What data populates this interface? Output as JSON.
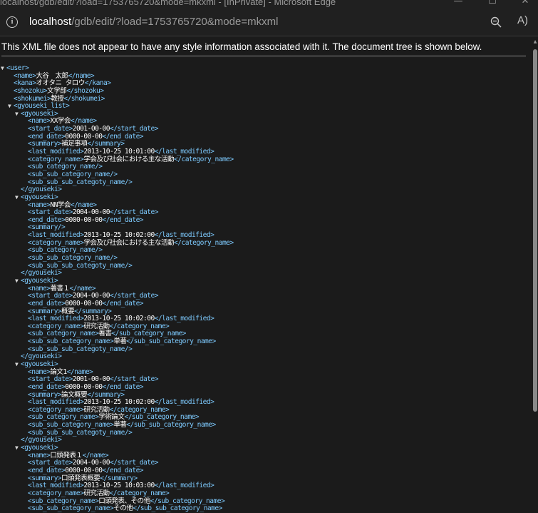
{
  "window": {
    "title": "localhost/gdb/edit/?load=1753765720&mode=mkxml - [InPrivate] - Microsoft Edge",
    "minimize_glyph": "—",
    "maximize_glyph": "☐",
    "close_glyph": "✕"
  },
  "address_bar": {
    "host": "localhost",
    "path": "/gdb/edit/?load=1753765720&mode=mkxml",
    "info_icon": "info-icon",
    "zoom_icon": "zoom-out-icon",
    "read_aloud_label": "A)"
  },
  "banner_text": "This XML file does not appear to have any style information associated with it. The document tree is shown below.",
  "xml_lines": [
    {
      "d": 0,
      "t": 1,
      "o": "<user>",
      "v": "",
      "c": ""
    },
    {
      "d": 1,
      "t": 0,
      "o": "<name>",
      "v": "大谷　太郎",
      "c": "</name>"
    },
    {
      "d": 1,
      "t": 0,
      "o": "<kana>",
      "v": "オオタニ タロウ",
      "c": "</kana>"
    },
    {
      "d": 1,
      "t": 0,
      "o": "<shozoku>",
      "v": "文学部",
      "c": "</shozoku>"
    },
    {
      "d": 1,
      "t": 0,
      "o": "<shokumei>",
      "v": "教授",
      "c": "</shokumei>"
    },
    {
      "d": 1,
      "t": 1,
      "o": "<gyouseki_list>",
      "v": "",
      "c": ""
    },
    {
      "d": 2,
      "t": 1,
      "o": "<gyouseki>",
      "v": "",
      "c": ""
    },
    {
      "d": 3,
      "t": 0,
      "o": "<name>",
      "v": "XX学会",
      "c": "</name>"
    },
    {
      "d": 3,
      "t": 0,
      "o": "<start_date>",
      "v": "2001-00-00",
      "c": "</start_date>"
    },
    {
      "d": 3,
      "t": 0,
      "o": "<end_date>",
      "v": "0000-00-00",
      "c": "</end_date>"
    },
    {
      "d": 3,
      "t": 0,
      "o": "<summary>",
      "v": "補足事項",
      "c": "</summary>"
    },
    {
      "d": 3,
      "t": 0,
      "o": "<last_modified>",
      "v": "2013-10-25 10:01:00",
      "c": "</last_modified>"
    },
    {
      "d": 3,
      "t": 0,
      "o": "<category_name>",
      "v": "学会及び社会における主な活動",
      "c": "</category_name>"
    },
    {
      "d": 3,
      "t": 0,
      "o": "<sub_category_name/>",
      "v": "",
      "c": ""
    },
    {
      "d": 3,
      "t": 0,
      "o": "<sub_sub_category_name/>",
      "v": "",
      "c": ""
    },
    {
      "d": 3,
      "t": 0,
      "o": "<sub_sub_sub_categoty_name/>",
      "v": "",
      "c": ""
    },
    {
      "d": 2,
      "t": 0,
      "o": "</gyouseki>",
      "v": "",
      "c": ""
    },
    {
      "d": 2,
      "t": 1,
      "o": "<gyouseki>",
      "v": "",
      "c": ""
    },
    {
      "d": 3,
      "t": 0,
      "o": "<name>",
      "v": "NN学会",
      "c": "</name>"
    },
    {
      "d": 3,
      "t": 0,
      "o": "<start_date>",
      "v": "2004-00-00",
      "c": "</start_date>"
    },
    {
      "d": 3,
      "t": 0,
      "o": "<end_date>",
      "v": "0000-00-00",
      "c": "</end_date>"
    },
    {
      "d": 3,
      "t": 0,
      "o": "<summary/>",
      "v": "",
      "c": ""
    },
    {
      "d": 3,
      "t": 0,
      "o": "<last_modified>",
      "v": "2013-10-25 10:02:00",
      "c": "</last_modified>"
    },
    {
      "d": 3,
      "t": 0,
      "o": "<category_name>",
      "v": "学会及び社会における主な活動",
      "c": "</category_name>"
    },
    {
      "d": 3,
      "t": 0,
      "o": "<sub_category_name/>",
      "v": "",
      "c": ""
    },
    {
      "d": 3,
      "t": 0,
      "o": "<sub_sub_category_name/>",
      "v": "",
      "c": ""
    },
    {
      "d": 3,
      "t": 0,
      "o": "<sub_sub_sub_categoty_name/>",
      "v": "",
      "c": ""
    },
    {
      "d": 2,
      "t": 0,
      "o": "</gyouseki>",
      "v": "",
      "c": ""
    },
    {
      "d": 2,
      "t": 1,
      "o": "<gyouseki>",
      "v": "",
      "c": ""
    },
    {
      "d": 3,
      "t": 0,
      "o": "<name>",
      "v": "著書１",
      "c": "</name>"
    },
    {
      "d": 3,
      "t": 0,
      "o": "<start_date>",
      "v": "2004-00-00",
      "c": "</start_date>"
    },
    {
      "d": 3,
      "t": 0,
      "o": "<end_date>",
      "v": "0000-00-00",
      "c": "</end_date>"
    },
    {
      "d": 3,
      "t": 0,
      "o": "<summary>",
      "v": "概要",
      "c": "</summary>"
    },
    {
      "d": 3,
      "t": 0,
      "o": "<last_modified>",
      "v": "2013-10-25 10:02:00",
      "c": "</last_modified>"
    },
    {
      "d": 3,
      "t": 0,
      "o": "<category_name>",
      "v": "研究活動",
      "c": "</category_name>"
    },
    {
      "d": 3,
      "t": 0,
      "o": "<sub_category_name>",
      "v": "著書",
      "c": "</sub_category_name>"
    },
    {
      "d": 3,
      "t": 0,
      "o": "<sub_sub_category_name>",
      "v": "単著",
      "c": "</sub_sub_category_name>"
    },
    {
      "d": 3,
      "t": 0,
      "o": "<sub_sub_sub_categoty_name/>",
      "v": "",
      "c": ""
    },
    {
      "d": 2,
      "t": 0,
      "o": "</gyouseki>",
      "v": "",
      "c": ""
    },
    {
      "d": 2,
      "t": 1,
      "o": "<gyouseki>",
      "v": "",
      "c": ""
    },
    {
      "d": 3,
      "t": 0,
      "o": "<name>",
      "v": "論文1",
      "c": "</name>"
    },
    {
      "d": 3,
      "t": 0,
      "o": "<start_date>",
      "v": "2001-00-00",
      "c": "</start_date>"
    },
    {
      "d": 3,
      "t": 0,
      "o": "<end_date>",
      "v": "0000-00-00",
      "c": "</end_date>"
    },
    {
      "d": 3,
      "t": 0,
      "o": "<summary>",
      "v": "論文概要",
      "c": "</summary>"
    },
    {
      "d": 3,
      "t": 0,
      "o": "<last_modified>",
      "v": "2013-10-25 10:02:00",
      "c": "</last_modified>"
    },
    {
      "d": 3,
      "t": 0,
      "o": "<category_name>",
      "v": "研究活動",
      "c": "</category_name>"
    },
    {
      "d": 3,
      "t": 0,
      "o": "<sub_category_name>",
      "v": "学術論文",
      "c": "</sub_category_name>"
    },
    {
      "d": 3,
      "t": 0,
      "o": "<sub_sub_category_name>",
      "v": "単著",
      "c": "</sub_sub_category_name>"
    },
    {
      "d": 3,
      "t": 0,
      "o": "<sub_sub_sub_categoty_name/>",
      "v": "",
      "c": ""
    },
    {
      "d": 2,
      "t": 0,
      "o": "</gyouseki>",
      "v": "",
      "c": ""
    },
    {
      "d": 2,
      "t": 1,
      "o": "<gyouseki>",
      "v": "",
      "c": ""
    },
    {
      "d": 3,
      "t": 0,
      "o": "<name>",
      "v": "口頭発表１",
      "c": "</name>"
    },
    {
      "d": 3,
      "t": 0,
      "o": "<start_date>",
      "v": "2004-00-00",
      "c": "</start_date>"
    },
    {
      "d": 3,
      "t": 0,
      "o": "<end_date>",
      "v": "0000-00-00",
      "c": "</end_date>"
    },
    {
      "d": 3,
      "t": 0,
      "o": "<summary>",
      "v": "口頭発表概要",
      "c": "</summary>"
    },
    {
      "d": 3,
      "t": 0,
      "o": "<last_modified>",
      "v": "2013-10-25 10:03:00",
      "c": "</last_modified>"
    },
    {
      "d": 3,
      "t": 0,
      "o": "<category_name>",
      "v": "研究活動",
      "c": "</category_name>"
    },
    {
      "d": 3,
      "t": 0,
      "o": "<sub_category_name>",
      "v": "口頭発表、その他",
      "c": "</sub_category_name>"
    },
    {
      "d": 3,
      "t": 0,
      "o": "<sub_sub_category_name>",
      "v": "その他",
      "c": "</sub_sub_category_name>"
    }
  ]
}
